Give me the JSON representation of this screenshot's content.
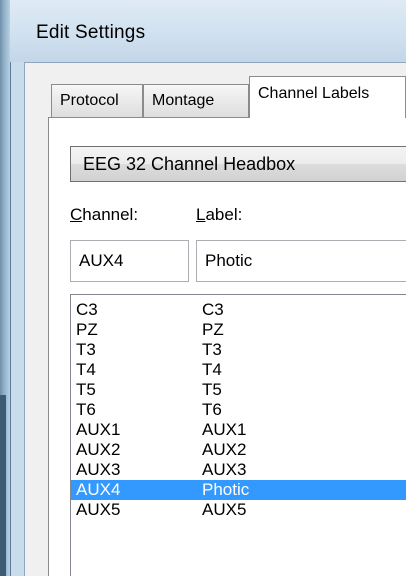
{
  "window": {
    "title": "Edit Settings"
  },
  "tabs": [
    {
      "label": "Protocol",
      "active": false
    },
    {
      "label": "Montage",
      "active": false
    },
    {
      "label": "Channel Labels",
      "active": true
    }
  ],
  "headbox": {
    "selected": "EEG 32 Channel Headbox"
  },
  "fields": {
    "channel_label_rest": "hannel:",
    "channel_label_accel": "C",
    "label_label_rest": "abel:",
    "label_label_accel": "L",
    "channel_value": "AUX4",
    "label_value": "Photic"
  },
  "list": {
    "selected_index": 10,
    "rows": [
      {
        "channel": "C3",
        "label": "C3"
      },
      {
        "channel": "PZ",
        "label": "PZ"
      },
      {
        "channel": "T3",
        "label": "T3"
      },
      {
        "channel": "T4",
        "label": "T4"
      },
      {
        "channel": "T5",
        "label": "T5"
      },
      {
        "channel": "T6",
        "label": "T6"
      },
      {
        "channel": "AUX1",
        "label": "AUX1"
      },
      {
        "channel": "AUX2",
        "label": "AUX2"
      },
      {
        "channel": "AUX3",
        "label": "AUX3"
      },
      {
        "channel": "AUX4",
        "label": "Photic"
      },
      {
        "channel": "AUX5",
        "label": "AUX5"
      }
    ]
  },
  "colors": {
    "selection": "#3399ff",
    "titlebar": "#cfe0ef",
    "dialog": "#f0f0f0"
  }
}
